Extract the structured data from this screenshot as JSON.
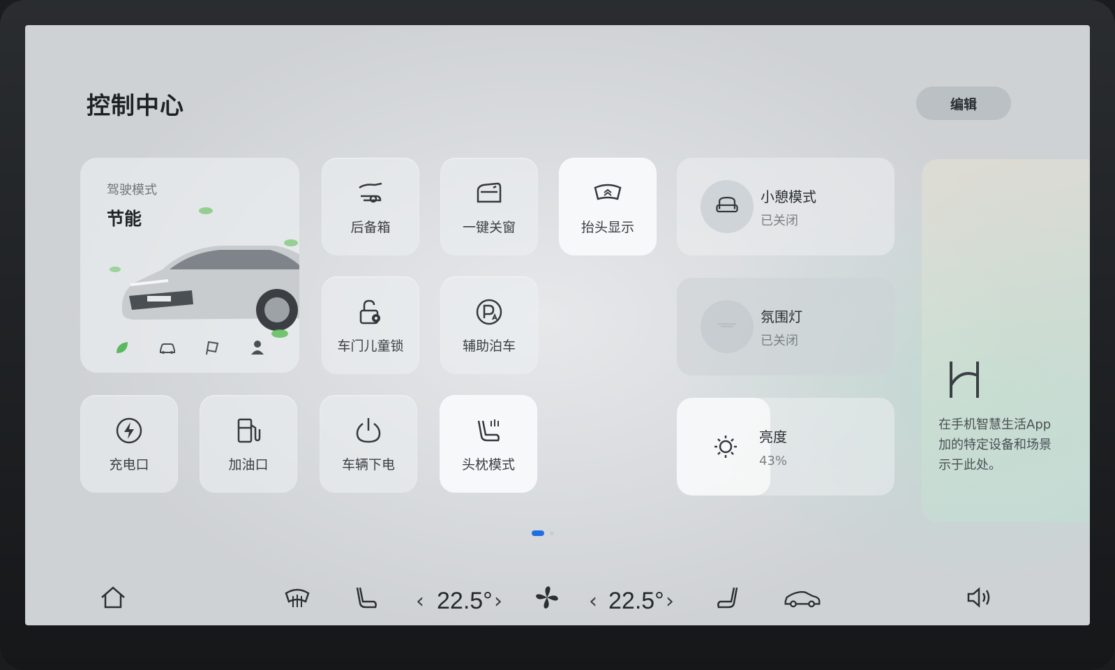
{
  "header": {
    "title": "控制中心",
    "edit_label": "编辑"
  },
  "drive_mode": {
    "label": "驾驶模式",
    "value": "节能",
    "mode_icons": [
      "leaf-icon",
      "car-icon",
      "flag-icon",
      "person-icon"
    ]
  },
  "tiles": {
    "trunk": {
      "label": "后备箱",
      "icon": "trunk-icon"
    },
    "windows": {
      "label": "一键关窗",
      "icon": "window-icon"
    },
    "hud": {
      "label": "抬头显示",
      "icon": "hud-icon"
    },
    "child_lock": {
      "label": "车门儿童锁",
      "icon": "child-lock-icon"
    },
    "parking": {
      "label": "辅助泊车",
      "icon": "parking-icon"
    },
    "charge": {
      "label": "充电口",
      "icon": "charge-icon"
    },
    "fuel": {
      "label": "加油口",
      "icon": "fuel-icon"
    },
    "power_off": {
      "label": "车辆下电",
      "icon": "power-icon"
    },
    "headrest": {
      "label": "头枕模式",
      "icon": "headrest-icon"
    }
  },
  "rest_mode": {
    "name": "小憩模式",
    "state": "已关闭",
    "icon": "seat-icon"
  },
  "ambient": {
    "name": "氛围灯",
    "state": "已关闭",
    "icon": "ambient-light-icon"
  },
  "brightness": {
    "name": "亮度",
    "value_text": "43%",
    "level": 0.43,
    "icon": "sun-icon"
  },
  "promo": {
    "text": "在手机智慧生活App\n加的特定设备和场景\n示于此处。",
    "icon": "harmony-logo-icon"
  },
  "pagination": {
    "pages": 2,
    "current": 1
  },
  "dock": {
    "left_temp": "22.5°",
    "right_temp": "22.5°",
    "icons": [
      "home-icon",
      "defrost-icon",
      "seat-heat-icon",
      "fan-icon",
      "seat-right-icon",
      "car-icon",
      "volume-icon"
    ]
  },
  "colors": {
    "accent": "#1f6fe0"
  }
}
